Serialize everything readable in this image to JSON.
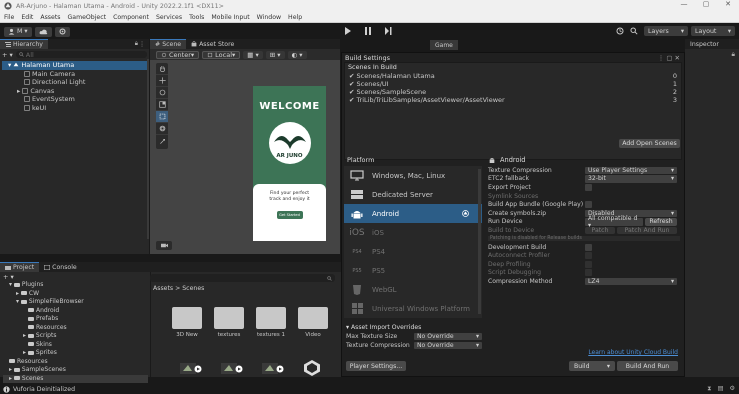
{
  "window": {
    "title": "AR-Arjuno - Halaman Utama - Android - Unity 2022.2.1f1 <DX11>",
    "controls": [
      "—",
      "▢",
      "✕"
    ]
  },
  "menu": [
    "File",
    "Edit",
    "Assets",
    "GameObject",
    "Component",
    "Services",
    "Tools",
    "Mobile Input",
    "Window",
    "Help"
  ],
  "toolbar": {
    "account": "M ▾",
    "layers": "Layers",
    "layout": "Layout"
  },
  "hierarchy": {
    "tab": "Hierarchy",
    "search_placeholder": "All",
    "root": "Halaman Utama",
    "items": [
      "Main Camera",
      "Directional Light",
      "Canvas",
      "EventSystem",
      "keUI"
    ]
  },
  "scene": {
    "tab_scene": "Scene",
    "tab_asset_store": "Asset Store",
    "pivot": "Center",
    "space": "Local",
    "preview": {
      "welcome": "WELCOME",
      "logo_text": "AR JUNO",
      "card_line1": "Find your perfect",
      "card_line2": "track and enjoy it",
      "button": "Get Started"
    }
  },
  "game_tab": "Game",
  "inspector_tab": "Inspector",
  "build_settings": {
    "title": "Build Settings",
    "scenes_header": "Scenes In Build",
    "scenes": [
      {
        "name": "Scenes/Halaman Utama",
        "index": "0"
      },
      {
        "name": "Scenes/UI",
        "index": "1"
      },
      {
        "name": "Scenes/SampleScene",
        "index": "2"
      },
      {
        "name": "TriLib/TriLibSamples/AssetViewer/AssetViewer",
        "index": "3"
      }
    ],
    "add_open_scenes": "Add Open Scenes",
    "platform_header": "Platform",
    "platforms": [
      {
        "name": "Windows, Mac, Linux",
        "icon": "monitor-icon",
        "state": "normal"
      },
      {
        "name": "Dedicated Server",
        "icon": "server-icon",
        "state": "normal"
      },
      {
        "name": "Android",
        "icon": "android-icon",
        "state": "selected"
      },
      {
        "name": "iOS",
        "icon": "ios-icon",
        "state": "dim"
      },
      {
        "name": "PS4",
        "icon": "ps4-icon",
        "state": "dim"
      },
      {
        "name": "PS5",
        "icon": "ps5-icon",
        "state": "dim"
      },
      {
        "name": "WebGL",
        "icon": "webgl-icon",
        "state": "dim"
      },
      {
        "name": "Universal Windows Platform",
        "icon": "windows-icon",
        "state": "dim"
      }
    ],
    "android_header": "Android",
    "settings": [
      {
        "label": "Texture Compression",
        "kind": "dropdown",
        "value": "Use Player Settings",
        "dim": false
      },
      {
        "label": "ETC2 fallback",
        "kind": "dropdown",
        "value": "32-bit",
        "dim": false
      },
      {
        "label": "Export Project",
        "kind": "checkbox",
        "dim": false
      },
      {
        "label": "Symlink Sources",
        "kind": "none",
        "dim": true
      },
      {
        "label": "Build App Bundle (Google Play)",
        "kind": "checkbox",
        "dim": false
      },
      {
        "label": "Create symbols.zip",
        "kind": "dropdown",
        "value": "Disabled",
        "dim": false
      },
      {
        "label": "Run Device",
        "kind": "dropdown-refresh",
        "value": "All compatible d ▾",
        "dim": false
      },
      {
        "label": "Build to Device",
        "kind": "patch",
        "dim": true
      },
      {
        "label": "Patching is disabled for Release builds",
        "kind": "note",
        "dim": true
      },
      {
        "label": "Development Build",
        "kind": "checkbox",
        "dim": false
      },
      {
        "label": "Autoconnect Profiler",
        "kind": "checkbox",
        "dim": true
      },
      {
        "label": "Deep Profiling",
        "kind": "checkbox",
        "dim": true
      },
      {
        "label": "Script Debugging",
        "kind": "checkbox",
        "dim": true
      },
      {
        "label": "Compression Method",
        "kind": "dropdown",
        "value": "LZ4",
        "dim": false
      }
    ],
    "refresh": "Refresh",
    "patch": "Patch",
    "patch_and_run": "Patch And Run",
    "import_overrides_header": "Asset Import Overrides",
    "max_texture_label": "Max Texture Size",
    "max_texture_value": "No Override",
    "texture_compression_label": "Texture Compression",
    "texture_compression_value": "No Override",
    "player_settings": "Player Settings...",
    "cloud_build_link": "Learn about Unity Cloud Build",
    "build": "Build",
    "build_and_run": "Build And Run"
  },
  "project": {
    "tab_project": "Project",
    "tab_console": "Console",
    "breadcrumb": "Assets > Scenes",
    "tree": [
      {
        "label": "Plugins",
        "depth": 0
      },
      {
        "label": "CW",
        "depth": 1
      },
      {
        "label": "SimpleFileBrowser",
        "depth": 1
      },
      {
        "label": "Android",
        "depth": 2
      },
      {
        "label": "Prefabs",
        "depth": 2
      },
      {
        "label": "Resources",
        "depth": 2
      },
      {
        "label": "Scripts",
        "depth": 2
      },
      {
        "label": "Skins",
        "depth": 2
      },
      {
        "label": "Sprites",
        "depth": 2
      },
      {
        "label": "Resources",
        "depth": 0
      },
      {
        "label": "SampleScenes",
        "depth": 0
      },
      {
        "label": "Scenes",
        "depth": 0
      }
    ],
    "assets": [
      "3D New",
      "textures",
      "textures 1",
      "Video"
    ]
  },
  "status": {
    "text": "Vuforia Deinitialized"
  },
  "colors": {
    "accent_blue": "#2c5d87",
    "link_blue": "#4c8fd6",
    "preview_green": "#3d7456",
    "button_green": "#3d7456"
  }
}
